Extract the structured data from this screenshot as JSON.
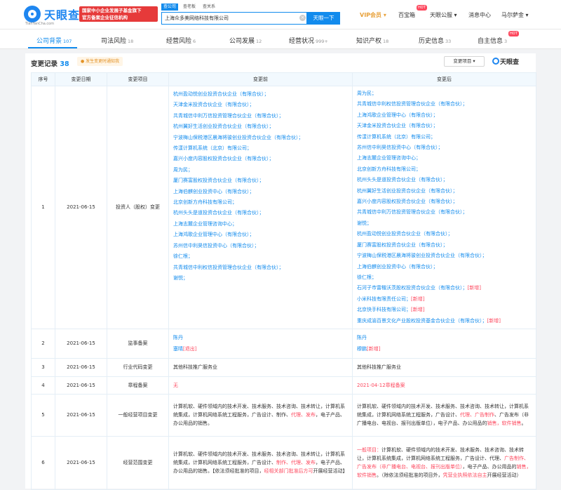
{
  "header": {
    "logo_name": "天眼查",
    "logo_sub": "TianYanCha.com",
    "promo_line1": "国家中小企业发展子基金旗下",
    "promo_line2": "官方备案企业征信机构",
    "search_tabs": [
      "查公司",
      "查老板",
      "查关系"
    ],
    "search_value": "上海众多美网络科技有限公司",
    "search_button": "天眼一下",
    "nav": {
      "vip": "VIP会员",
      "baibaoxiang": "百宝箱",
      "hot1": "HOT",
      "tianyan_app": "天眼公服",
      "messages": "消息中心",
      "user": "马尔萨金",
      "hot2": "HOT"
    }
  },
  "tabs": [
    {
      "label": "公司背景",
      "count": "107"
    },
    {
      "label": "司法风险",
      "count": "18"
    },
    {
      "label": "经营风险",
      "count": "6"
    },
    {
      "label": "公司发展",
      "count": "12"
    },
    {
      "label": "经营状况",
      "count": "999+"
    },
    {
      "label": "知识产权",
      "count": "18"
    },
    {
      "label": "历史信息",
      "count": "33"
    },
    {
      "label": "自主信息",
      "count": "3"
    }
  ],
  "section": {
    "title": "变更记录",
    "count": "38",
    "tag": "发生变更时通知我",
    "filter": "变更项目",
    "brand": "天眼查"
  },
  "table": {
    "headers": [
      "序号",
      "变更日期",
      "变更项目",
      "变更前",
      "变更后"
    ],
    "row1": {
      "num": "1",
      "date": "2021-06-15",
      "item": "投资人（股权）变更",
      "before": [
        "杭州盈动悦创业投资合伙企业（有限合伙）；",
        "天津金米投资合伙企业（有限合伙）；",
        "共青城信中利万信投资管理合伙企业（有限合伙）；",
        "杭州翼好生活创业投资合伙企业（有限合伙）；",
        "宁波梅山保税港区晨海将骏创业投资合伙企业（有限合伙）；",
        "传漾计算机系统（北京）有限公司；",
        "嘉兴小度内容股权投资合伙企业（有限合伙）；",
        "周为民；",
        "厦门赛富股权投资合伙企业（有限合伙）；",
        "上海伯麒创业投资中心（有限合伙）；",
        "北京创新方舟科技有限公司；",
        "杭州头头是道投资合伙企业（有限合伙）；",
        "上海志麓企业管理咨询中心；",
        "上海鸿歌企业管理中心（有限合伙）；",
        "苏州信中利昊信投资中心（有限合伙）；",
        "徐仁根；",
        "共青城信中利权信投资管理合伙企业（有限合伙）；",
        "谢悦；"
      ],
      "after": [
        {
          "t": "周为民；",
          "n": ""
        },
        {
          "t": "共青城信中利权信投资管理合伙企业（有限合伙）；",
          "n": ""
        },
        {
          "t": "上海鸿歌企业管理中心（有限合伙）；",
          "n": ""
        },
        {
          "t": "天津金米投资合伙企业（有限合伙）；",
          "n": ""
        },
        {
          "t": "传漾计算机系统（北京）有限公司；",
          "n": ""
        },
        {
          "t": "苏州信中利昊信投资中心（有限合伙）；",
          "n": ""
        },
        {
          "t": "上海志麓企业管理咨询中心；",
          "n": ""
        },
        {
          "t": "北京创新方舟科技有限公司；",
          "n": ""
        },
        {
          "t": "杭州头头是道投资合伙企业（有限合伙）；",
          "n": ""
        },
        {
          "t": "杭州翼好生活创业投资合伙企业（有限合伙）；",
          "n": ""
        },
        {
          "t": "嘉兴小度内容股权投资合伙企业（有限合伙）；",
          "n": ""
        },
        {
          "t": "共青城信中利万信投资管理合伙企业（有限合伙）；",
          "n": ""
        },
        {
          "t": "谢悦；",
          "n": ""
        },
        {
          "t": "杭州盈动悦创业投资合伙企业（有限合伙）；",
          "n": ""
        },
        {
          "t": "厦门赛富股权投资合伙企业（有限合伙）；",
          "n": ""
        },
        {
          "t": "宁波梅山保税港区晨海将骏创业投资合伙企业（有限合伙）；",
          "n": ""
        },
        {
          "t": "上海伯麒创业投资中心（有限合伙）；",
          "n": ""
        },
        {
          "t": "徐仁根；",
          "n": ""
        },
        {
          "t": "石河子市雷楷沃茨股权投资合伙企业（有限合伙）；",
          "n": "[新增]"
        },
        {
          "t": "小米科技有限责任公司；",
          "n": "[新增]"
        },
        {
          "t": "北京快手科技有限公司；",
          "n": "[新增]"
        },
        {
          "t": "重庆成渝百景文化产业股权投资基金合伙企业（有限合伙）；",
          "n": "[新增]"
        }
      ]
    },
    "row2": {
      "num": "2",
      "date": "2021-06-15",
      "item": "监事备案",
      "before1": "陈丹",
      "before2": "塞晴",
      "before2_note": "[退出]",
      "after1": "陈丹",
      "after2": "穆鹏",
      "after2_note": "[新增]"
    },
    "row3": {
      "num": "3",
      "date": "2021-06-15",
      "item": "行业代码变更",
      "before": "其他科技推广服务业",
      "after": "其他科技推广服务业"
    },
    "row4": {
      "num": "4",
      "date": "2021-06-15",
      "item": "章程备案",
      "before": "无",
      "after": "2021-04-12章程备案"
    },
    "row5": {
      "num": "5",
      "date": "2021-06-15",
      "item": "一般经营项目变更",
      "before_a": "计算机软、硬件领域内的技术开发、技术服务、技术咨询、技术转让，计算机系统集成，计算机网络系统工程服务，广告设计、制作、",
      "before_r1": "代理、发布",
      "before_b": "，电子产品、办公用品的销售。",
      "after_a": "计算机软、硬件领域内的技术开发、技术服务、技术咨询、技术转让，计算机系统集成，计算机网络系统工程服务，广告设计、",
      "after_r1": "代理、广告制作",
      "after_b": "、广告发布（非广播电台、电视台、报刊出版单位），电子产品、办公用品的",
      "after_r2": "销售，软件销售",
      "after_c": "。"
    },
    "row6": {
      "num": "6",
      "date": "2021-06-15",
      "item": "经营范围变更",
      "before_a": "计算机软、硬件领域内的技术开发、技术服务、技术咨询、技术转让，计算机系统集成，计算机网络系统工程服务，广告设计、",
      "before_r1": "制作、代理、发布",
      "before_b": "，电子产品、办公用品的销售。【依法须经批准的项目，",
      "before_r2": "经相关部门批准后方可",
      "before_c": "开展经营活动】",
      "after_r0": "一般项目：",
      "after_a": "计算机软、硬件领域内的技术开发、技术服务、技术咨询、技术转让，计算机系统集成，计算机网络系统工程服务，广告设计、代理、",
      "after_r1": "广告制作、广告发布（非广播电台、电视台、报刊出版单位）",
      "after_b": "，电子产品、办公用品的",
      "after_r2": "销售，软件销售",
      "after_c": "。（除依法须经批准的项目外，",
      "after_r3": "凭营业执照依法自主",
      "after_d": "开展经营活动）"
    }
  }
}
